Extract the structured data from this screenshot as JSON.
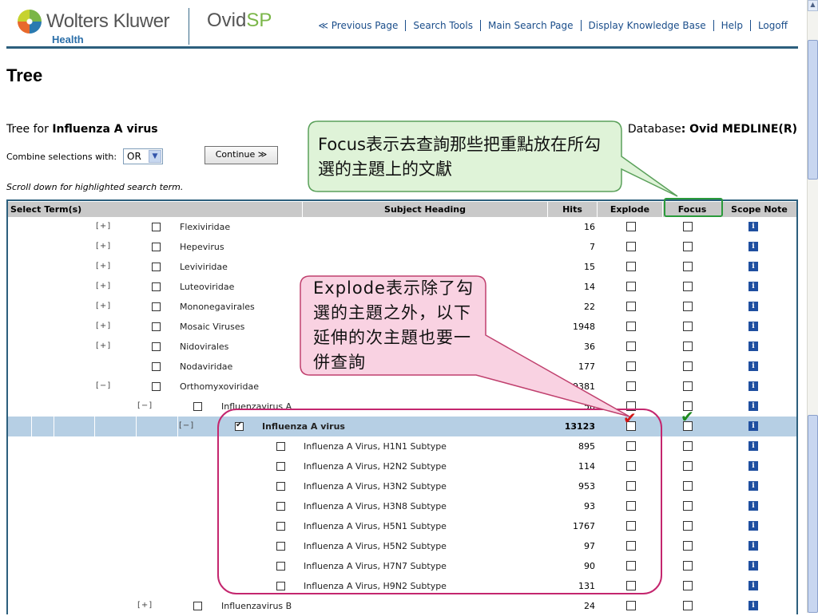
{
  "header": {
    "brand": "Wolters Kluwer",
    "brand_sub": "Health",
    "product_main": "Ovid",
    "product_accent": "SP",
    "nav": [
      {
        "label": "≪ Previous Page",
        "name": "nav-previous-page"
      },
      {
        "label": "Search Tools",
        "name": "nav-search-tools"
      },
      {
        "label": "Main Search Page",
        "name": "nav-main-search-page"
      },
      {
        "label": "Display Knowledge Base",
        "name": "nav-display-knowledge-base"
      },
      {
        "label": "Help",
        "name": "nav-help"
      },
      {
        "label": "Logoff",
        "name": "nav-logoff"
      }
    ]
  },
  "page": {
    "title": "Tree",
    "tree_for_prefix": "Tree for ",
    "tree_for_term": "Influenza A virus",
    "database_prefix": "Database",
    "database_sep": ": ",
    "database_name": "Ovid MEDLINE(R)",
    "combine_label": "Combine selections with:",
    "combine_value": "OR",
    "continue_label": "Continue ≫",
    "scroll_note": "Scroll down for highlighted search term."
  },
  "table": {
    "columns": {
      "select": "Select Term(s)",
      "subject": "Subject Heading",
      "hits": "Hits",
      "explode": "Explode",
      "focus": "Focus",
      "scope": "Scope Note"
    },
    "rows": [
      {
        "level": 2,
        "toggle": "[+]",
        "term": "Flexiviridae",
        "hits": "16",
        "checked": false
      },
      {
        "level": 2,
        "toggle": "[+]",
        "term": "Hepevirus",
        "hits": "7",
        "checked": false
      },
      {
        "level": 2,
        "toggle": "[+]",
        "term": "Leviviridae",
        "hits": "15",
        "checked": false
      },
      {
        "level": 2,
        "toggle": "[+]",
        "term": "Luteoviridae",
        "hits": "14",
        "checked": false
      },
      {
        "level": 2,
        "toggle": "[+]",
        "term": "Mononegavirales",
        "hits": "22",
        "checked": false
      },
      {
        "level": 2,
        "toggle": "[+]",
        "term": "Mosaic Viruses",
        "hits": "1948",
        "checked": false
      },
      {
        "level": 2,
        "toggle": "[+]",
        "term": "Nidovirales",
        "hits": "36",
        "checked": false
      },
      {
        "level": 2,
        "toggle": "",
        "term": "Nodaviridae",
        "hits": "177",
        "checked": false
      },
      {
        "level": 2,
        "toggle": "[−]",
        "term": "Orthomyxoviridae",
        "hits": "9381",
        "checked": false
      },
      {
        "level": 3,
        "toggle": "[−]",
        "term": "Influenzavirus A",
        "hits": "58",
        "checked": false
      },
      {
        "level": 4,
        "toggle": "[−]",
        "term": "Influenza A virus",
        "hits": "13123",
        "checked": true,
        "highlight": true
      },
      {
        "level": 5,
        "toggle": "",
        "term": "Influenza A Virus, H1N1 Subtype",
        "hits": "895",
        "checked": false
      },
      {
        "level": 5,
        "toggle": "",
        "term": "Influenza A Virus, H2N2 Subtype",
        "hits": "114",
        "checked": false
      },
      {
        "level": 5,
        "toggle": "",
        "term": "Influenza A Virus, H3N2 Subtype",
        "hits": "953",
        "checked": false
      },
      {
        "level": 5,
        "toggle": "",
        "term": "Influenza A Virus, H3N8 Subtype",
        "hits": "93",
        "checked": false
      },
      {
        "level": 5,
        "toggle": "",
        "term": "Influenza A Virus, H5N1 Subtype",
        "hits": "1767",
        "checked": false
      },
      {
        "level": 5,
        "toggle": "",
        "term": "Influenza A Virus, H5N2 Subtype",
        "hits": "97",
        "checked": false
      },
      {
        "level": 5,
        "toggle": "",
        "term": "Influenza A Virus, H7N7 Subtype",
        "hits": "90",
        "checked": false
      },
      {
        "level": 5,
        "toggle": "",
        "term": "Influenza A Virus, H9N2 Subtype",
        "hits": "131",
        "checked": false
      },
      {
        "level": 3,
        "toggle": "[+]",
        "term": "Influenzavirus B",
        "hits": "24",
        "checked": false
      }
    ]
  },
  "annotations": {
    "focus_callout": "Focus表示去查詢那些把重點放在所勾選的主題上的文獻",
    "explode_callout": "Explode表示除了勾選的主題之外，以下延伸的次主題也要一併查詢",
    "colors": {
      "focus_box": "#2a9a3a",
      "explode_box": "#c4266e",
      "green_fill": "#dff3d8",
      "pink_fill": "#f9d2e2"
    }
  }
}
